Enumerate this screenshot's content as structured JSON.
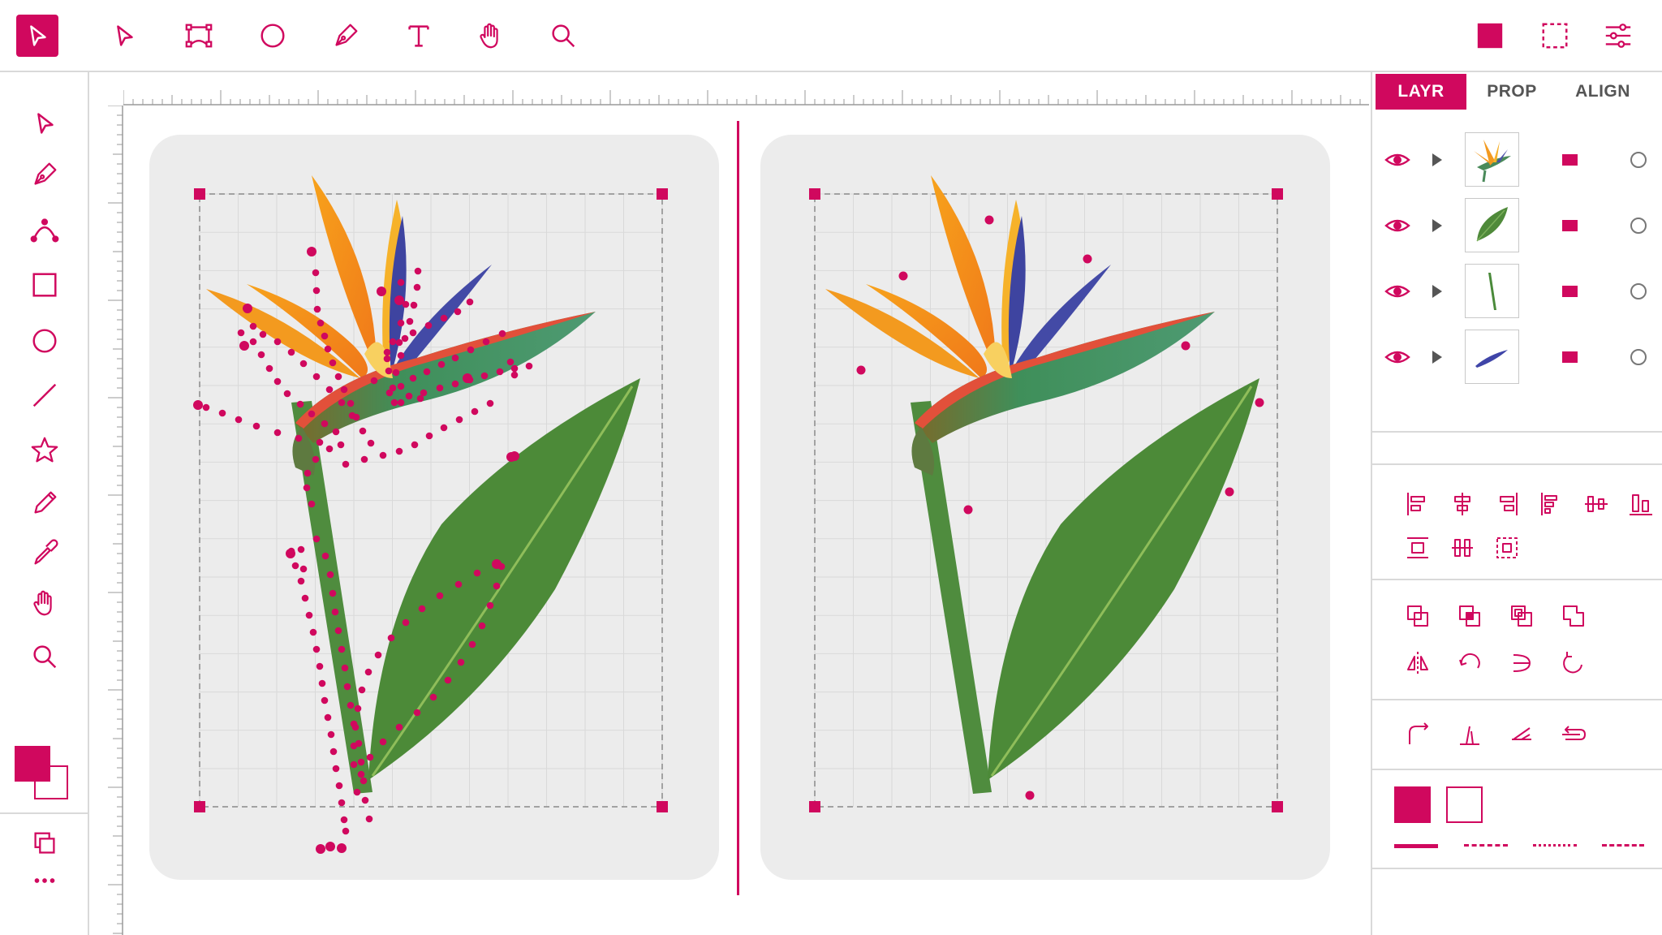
{
  "colors": {
    "accent": "#d0085e",
    "panel_bg": "#ececec"
  },
  "top_toolbar": {
    "left_tools": [
      "select-arrow-icon",
      "direct-select-icon",
      "transform-icon",
      "ellipse-icon",
      "pen-icon",
      "text-icon",
      "hand-icon",
      "zoom-icon"
    ],
    "right_tools": [
      "fill-square-icon",
      "selection-marquee-icon",
      "settings-sliders-icon"
    ]
  },
  "left_toolbar": {
    "tools": [
      "select-icon",
      "pen-icon",
      "curve-icon",
      "rectangle-icon",
      "ellipse-icon",
      "line-icon",
      "star-icon",
      "pencil-icon",
      "eyedropper-icon",
      "hand-icon",
      "zoom-icon"
    ],
    "bottom": [
      "arrange-icon",
      "more-icon"
    ]
  },
  "right_panel": {
    "tabs": [
      {
        "label": "LAYR",
        "active": true
      },
      {
        "label": "PROP",
        "active": false
      },
      {
        "label": "ALIGN",
        "active": false
      }
    ],
    "layers": [
      {
        "thumb": "flower-head"
      },
      {
        "thumb": "leaf"
      },
      {
        "thumb": "stem"
      },
      {
        "thumb": "blue-petal"
      }
    ],
    "align_icons": [
      "align-left-icon",
      "align-center-h-icon",
      "align-right-icon",
      "align-top-icon",
      "align-middle-v-icon",
      "align-bottom-icon",
      "distribute-top-icon",
      "distribute-center-icon",
      "distribute-bottom-icon"
    ],
    "pathfinder_icons": [
      "unite-icon",
      "minus-front-icon",
      "intersect-icon",
      "exclude-icon",
      "flip-h-icon",
      "rotate-icon",
      "reflect-icon",
      "rotate-ccw-icon"
    ],
    "transform_icons": [
      "corner-round-icon",
      "skew-icon",
      "shear-icon",
      "path-direction-icon"
    ],
    "stroke_styles": [
      "solid",
      "dashed",
      "dotted",
      "long-dash"
    ]
  }
}
